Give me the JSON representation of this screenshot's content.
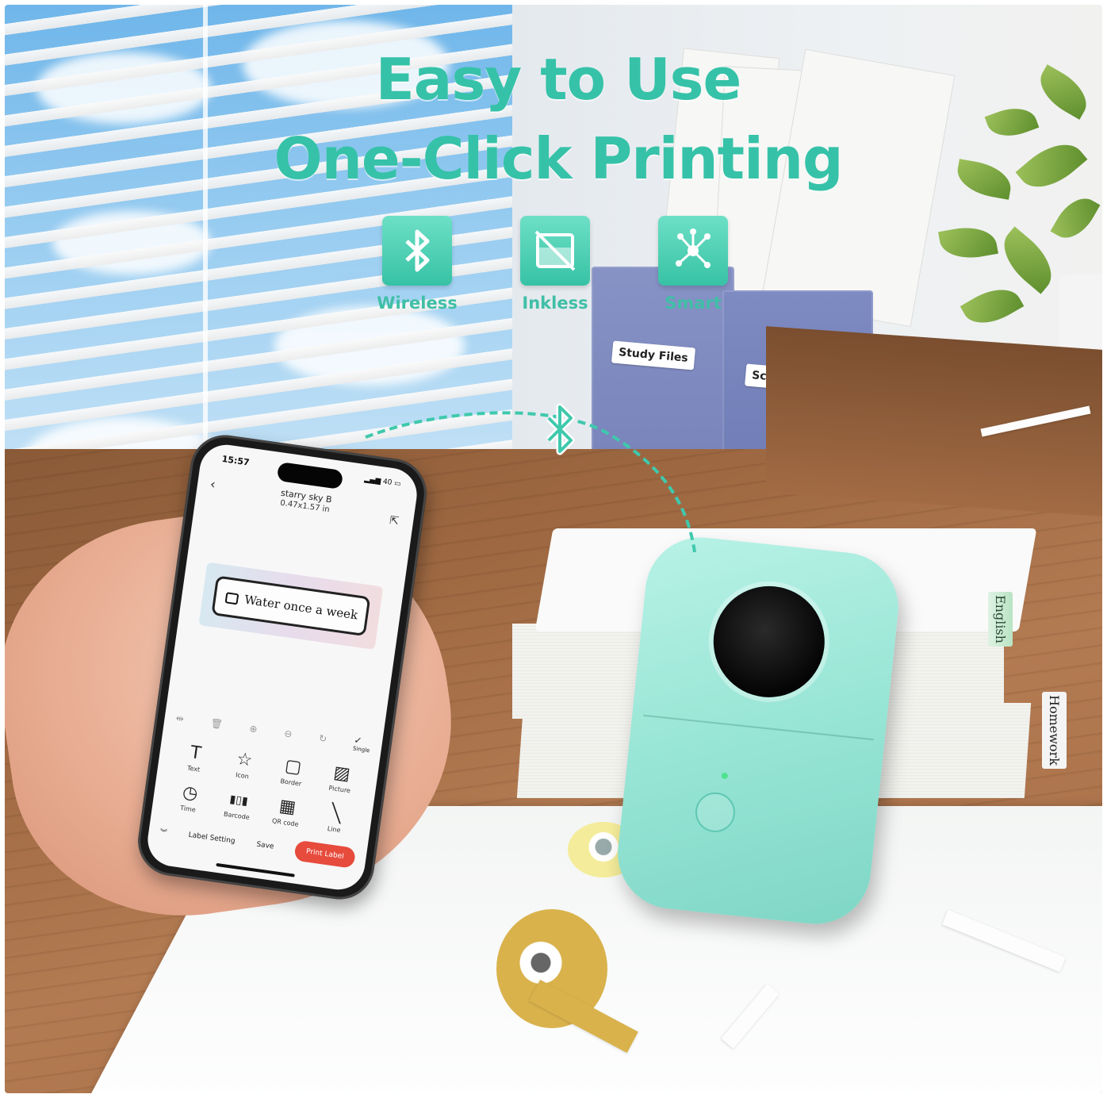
{
  "headline": {
    "line1": "Easy to Use",
    "line2": "One-Click Printing"
  },
  "features": [
    {
      "label": "Wireless",
      "icon": "bluetooth-icon"
    },
    {
      "label": "Inkless",
      "icon": "inkless-icon"
    },
    {
      "label": "Smart",
      "icon": "network-icon"
    }
  ],
  "folders": {
    "study": "Study Files",
    "science": "Science Books"
  },
  "books": {
    "english": "English",
    "homework": "Homework"
  },
  "phone": {
    "time": "15:57",
    "status": "40",
    "title": "starry sky B",
    "size": "0.47x1.57 in",
    "label_text": "Water once a week",
    "toolbar_action": "Single",
    "tools": [
      {
        "label": "Text",
        "icon": "T"
      },
      {
        "label": "Icon",
        "icon": "☆"
      },
      {
        "label": "Border",
        "icon": "▢"
      },
      {
        "label": "Picture",
        "icon": "▨"
      },
      {
        "label": "Time",
        "icon": "◷"
      },
      {
        "label": "Barcode",
        "icon": "▮▯▮"
      },
      {
        "label": "QR code",
        "icon": "▦"
      },
      {
        "label": "Line",
        "icon": "╲"
      }
    ],
    "label_setting": "Label Setting",
    "save": "Save",
    "print_label": "Print Label"
  },
  "colors": {
    "accent": "#36c2a8",
    "printer": "#95e4d4",
    "print_button": "#e64b3c"
  }
}
